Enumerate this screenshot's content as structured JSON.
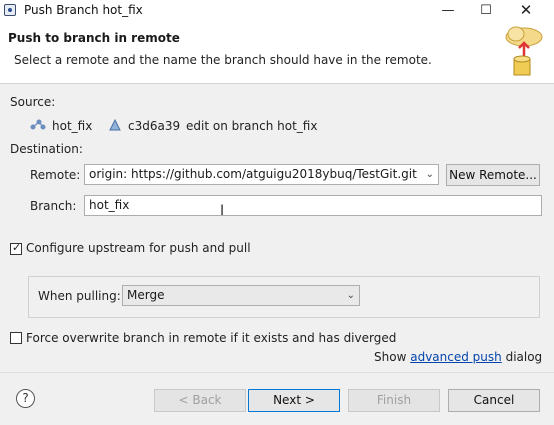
{
  "window": {
    "title": "Push Branch hot_fix",
    "minimize": "—",
    "maximize": "☐",
    "close": "✕"
  },
  "banner": {
    "title": "Push to branch in remote",
    "description": "Select a remote and the name the branch should have in the remote."
  },
  "source": {
    "label": "Source:",
    "branch": "hot_fix",
    "commit_id": "c3d6a39",
    "commit_msg": "edit on branch hot_fix"
  },
  "destination": {
    "label": "Destination:",
    "remote_label": "Remote:",
    "remote_value": "origin: https://github.com/atguigu2018ybuq/TestGit.git",
    "new_remote_label": "New Remote...",
    "branch_label": "Branch:",
    "branch_value": "hot_fix"
  },
  "upstream": {
    "configure_label": "Configure upstream for push and pull",
    "configure_checked": true,
    "when_pulling_label": "When pulling:",
    "when_pulling_value": "Merge"
  },
  "force": {
    "label": "Force overwrite branch in remote if it exists and has diverged",
    "checked": false
  },
  "advanced": {
    "prefix": "Show",
    "link": "advanced push",
    "suffix": "dialog"
  },
  "buttons": {
    "back": "< Back",
    "next": "Next >",
    "finish": "Finish",
    "cancel": "Cancel",
    "help": "?"
  },
  "colors": {
    "link": "#0645ad",
    "default_border": "#0078d7",
    "banner_bg": "#ffffff"
  }
}
